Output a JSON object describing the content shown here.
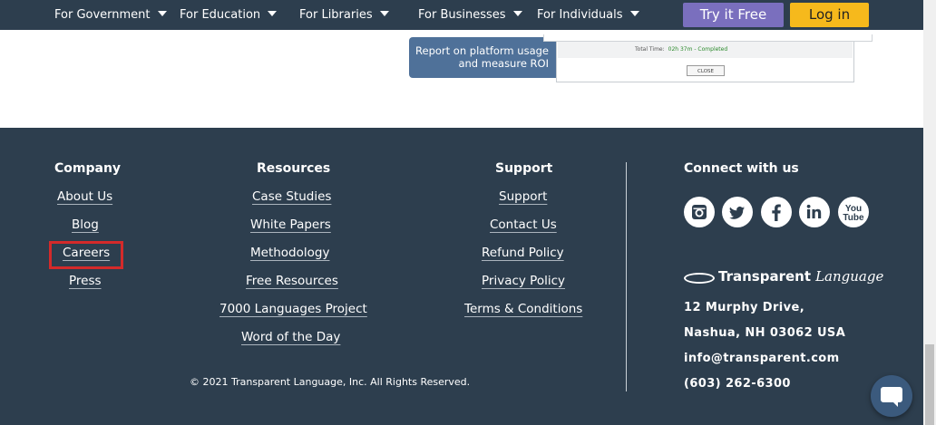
{
  "nav": {
    "items": [
      {
        "label": "For Government"
      },
      {
        "label": "For Education"
      },
      {
        "label": "For Libraries"
      },
      {
        "label": "For Businesses"
      },
      {
        "label": "For Individuals"
      }
    ],
    "try_label": "Try it Free",
    "login_label": "Log in"
  },
  "promo": {
    "report_line1": "Report on platform usage",
    "report_line2": "and measure ROI",
    "total_time_label": "Total Time:",
    "total_time_value": "02h 37m - Completed",
    "close_label": "CLOSE"
  },
  "footer": {
    "company": {
      "title": "Company",
      "links": [
        "About Us",
        "Blog",
        "Careers",
        "Press"
      ]
    },
    "resources": {
      "title": "Resources",
      "links": [
        "Case Studies",
        "White Papers",
        "Methodology",
        "Free Resources",
        "7000 Languages Project",
        "Word of the Day"
      ]
    },
    "support": {
      "title": "Support",
      "links": [
        "Support",
        "Contact Us",
        "Refund Policy",
        "Privacy Policy",
        "Terms & Conditions"
      ]
    },
    "connect": {
      "title": "Connect with us",
      "social": [
        "instagram-icon",
        "twitter-icon",
        "facebook-icon",
        "linkedin-icon",
        "youtube-icon"
      ],
      "youtube_you": "You",
      "youtube_tube": "Tube"
    },
    "logo_bold": "Transparent",
    "logo_italic": "Language",
    "address1": "12 Murphy Drive,",
    "address2": "Nashua, NH 03062 USA",
    "email": "info@transparent.com",
    "phone": "(603) 262-6300",
    "copyright": "© 2021 Transparent Language, Inc. All Rights Reserved."
  },
  "colors": {
    "nav_bg": "#2d3e4e",
    "footer_bg": "#2d3e4e",
    "try_button": "#7a6fbe",
    "login_button": "#f6b91c",
    "highlight": "#d42a2a"
  }
}
